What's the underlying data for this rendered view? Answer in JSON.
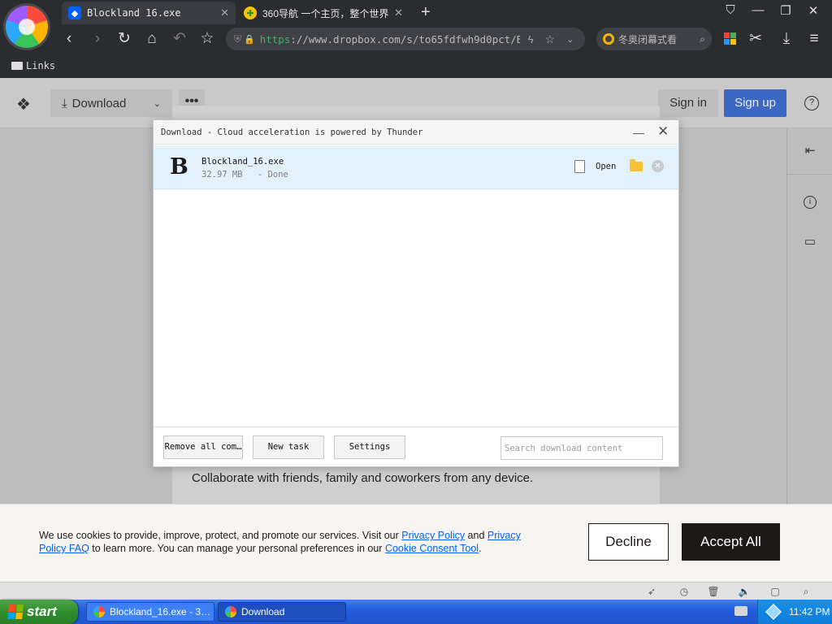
{
  "browser": {
    "tabs": [
      {
        "title": "Blockland 16.exe",
        "active": true
      },
      {
        "title": "360导航 一个主页，整个世界",
        "active": false
      }
    ],
    "url_scheme": "https",
    "url_rest": "://www.dropbox.com/s/to65fdfwh9d0pct/B",
    "search_text": "冬奥闭幕式看",
    "bookmark_folder": "Links"
  },
  "dropbox": {
    "download_label": "Download",
    "more_label": "•••",
    "sign_in": "Sign in",
    "sign_up": "Sign up",
    "help": "?",
    "collab_text": "Collaborate with friends, family and coworkers from any device."
  },
  "download_dialog": {
    "title": "Download - Cloud acceleration is powered by Thunder",
    "file_icon_letter": "B",
    "file_name": "Blockland_16.exe",
    "file_size": "32.97 MB",
    "file_status": "- Done",
    "open_label": "Open",
    "remove_all_label": "Remove all com…",
    "new_task_label": "New task",
    "settings_label": "Settings",
    "search_placeholder": "Search download content"
  },
  "cookie_banner": {
    "text_1": "We use cookies to provide, improve, protect, and promote our services. Visit our ",
    "link_privacy_policy": "Privacy Policy",
    "text_and": " and ",
    "link_privacy_faq": "Privacy Policy FAQ",
    "text_2": " to learn more. You can manage your personal preferences in our ",
    "link_cookie_tool": "Cookie Consent Tool",
    "text_3": ".",
    "decline_label": "Decline",
    "accept_label": "Accept All"
  },
  "taskbar": {
    "start_label": "start",
    "tasks": [
      {
        "label": "Blockland_16.exe - 3…"
      },
      {
        "label": "Download"
      }
    ],
    "clock": "11:42 PM"
  },
  "colors": {
    "accent_blue": "#3d67c4",
    "link_blue": "#0061fe",
    "download_row_bg": "#e2f1fb",
    "accept_bg": "#1e1919"
  }
}
